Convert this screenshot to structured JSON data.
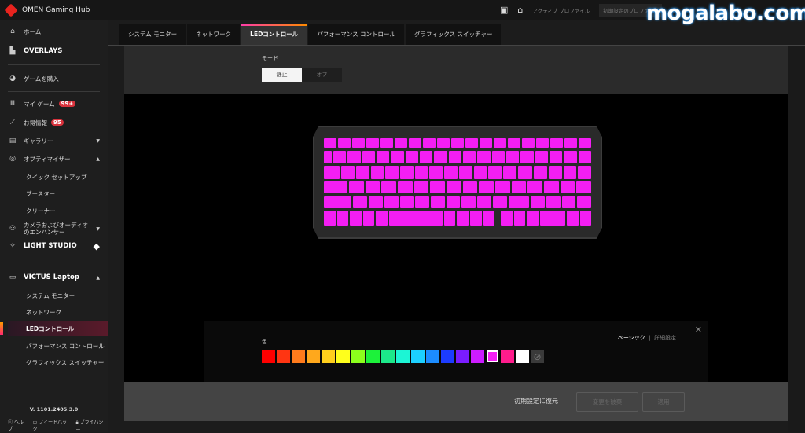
{
  "app": {
    "title": "OMEN Gaming Hub"
  },
  "topbar": {
    "active_profile_label": "アクティブ プロファイル",
    "profile_value": "初期設定のプロファ...",
    "watermark": "mogalabo.com"
  },
  "sidebar": {
    "home": "ホーム",
    "overlays": "OVERLAYS",
    "buy_games": "ゲームを購入",
    "my_games": "マイ ゲーム",
    "my_games_badge": "99+",
    "deals": "お得情報",
    "deals_badge": "95",
    "gallery": "ギャラリー",
    "optimizer": "オプティマイザー",
    "optimizer_items": [
      "クイック セットアップ",
      "ブースター",
      "クリーナー"
    ],
    "camera_audio": "カメラおよびオーディオのエンハンサー",
    "light_studio": "LIGHT STUDIO",
    "device": "VICTUS Laptop",
    "device_items": [
      "システム モニター",
      "ネットワーク",
      "LEDコントロール",
      "パフォーマンス コントロール",
      "グラフィックス スイッチャー"
    ],
    "active_device_item": "LEDコントロール",
    "version": "V. 1101.2405.3.0",
    "footer": [
      "ヘルプ",
      "フィードバック",
      "プライバシー"
    ]
  },
  "tabs": [
    {
      "label": "システム モニター",
      "active": false
    },
    {
      "label": "ネットワーク",
      "active": false
    },
    {
      "label": "LEDコントロール",
      "active": true
    },
    {
      "label": "パフォーマンス コントロール",
      "active": false
    },
    {
      "label": "グラフィックス スイッチャー",
      "active": false
    }
  ],
  "mode": {
    "label": "モード",
    "options": [
      "静止",
      "オフ"
    ],
    "selected": "静止"
  },
  "keyboard": {
    "backlight_color": "#f41ef4"
  },
  "color_panel": {
    "label": "色",
    "tab_basic": "ベーシック",
    "separator": "|",
    "tab_advanced": "詳細設定",
    "swatches": [
      "#ff0000",
      "#ff3512",
      "#ff7b1c",
      "#ffa81c",
      "#ffcf1c",
      "#ffff1c",
      "#8cff1c",
      "#1cf23a",
      "#1ce88a",
      "#1cf5d5",
      "#1cd0ff",
      "#1c8cff",
      "#1c3cff",
      "#7a1cff",
      "#cc1cff",
      "#f41ef4",
      "#ff1c8c",
      "#ffffff"
    ],
    "selected": "#f41ef4",
    "none_swatch": "⊘"
  },
  "actions": {
    "reset": "初期設定に復元",
    "discard": "変更を破棄",
    "apply": "適用"
  }
}
